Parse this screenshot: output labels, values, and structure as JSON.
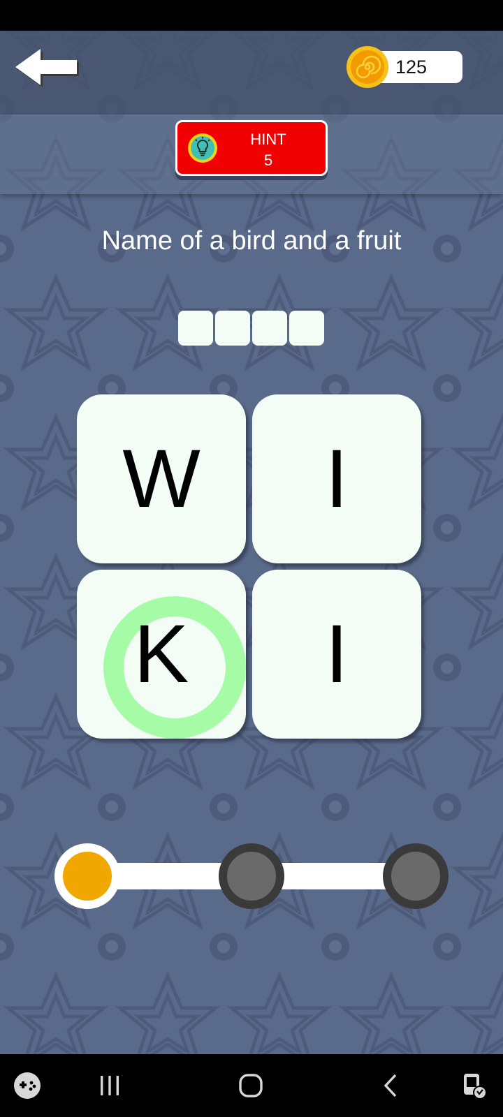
{
  "header": {
    "coins": "125"
  },
  "hint": {
    "label": "HINT",
    "count": "5"
  },
  "question": {
    "text": "Name of a bird and a fruit",
    "answer_slots": [
      "",
      "",
      "",
      ""
    ]
  },
  "letters": [
    {
      "letter": "W",
      "highlighted": false
    },
    {
      "letter": "I",
      "highlighted": false
    },
    {
      "letter": "K",
      "highlighted": true
    },
    {
      "letter": "I",
      "highlighted": false
    }
  ],
  "progress": {
    "current_step": 1,
    "total_steps": 3
  },
  "colors": {
    "background": "#5a6a8a",
    "hint_button": "#f00000",
    "tile": "#f3fdf6",
    "highlight_ring": "#a6fca6",
    "progress_done": "#f0a800",
    "progress_pending": "#6a6a6a",
    "coin": "#f3a900"
  },
  "icons": {
    "back": "arrow-left-icon",
    "coin": "coin-icon",
    "hint": "lightbulb-icon",
    "nav": [
      "game-launcher-icon",
      "recent-apps-icon",
      "home-icon",
      "back-nav-icon",
      "accessibility-icon"
    ]
  }
}
